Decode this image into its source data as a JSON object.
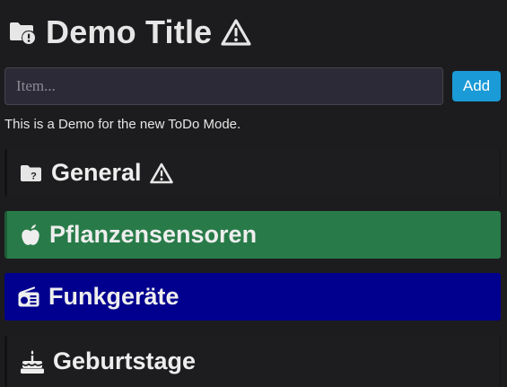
{
  "header": {
    "title": "Demo Title",
    "folder_icon": "folder-alert-icon",
    "warning_icon": "warning-triangle-icon"
  },
  "todo_input": {
    "placeholder": "Item...",
    "value": "",
    "add_label": "Add"
  },
  "description": "This is a Demo for the new ToDo Mode.",
  "sections": [
    {
      "label": "General",
      "icon": "folder-question-icon",
      "badge_icon": "warning-triangle-icon",
      "color": "#1d1d1f"
    },
    {
      "label": "Pflanzensensoren",
      "icon": "apple-icon",
      "color": "#287b48"
    },
    {
      "label": "Funkgeräte",
      "icon": "radio-icon",
      "color": "#01008e"
    },
    {
      "label": "Geburtstage",
      "icon": "birthday-cake-icon",
      "color": "#1d1d1f"
    }
  ],
  "colors": {
    "background": "#1c1c1e",
    "accent": "#1a9ad6",
    "text": "#e6e6e6"
  }
}
